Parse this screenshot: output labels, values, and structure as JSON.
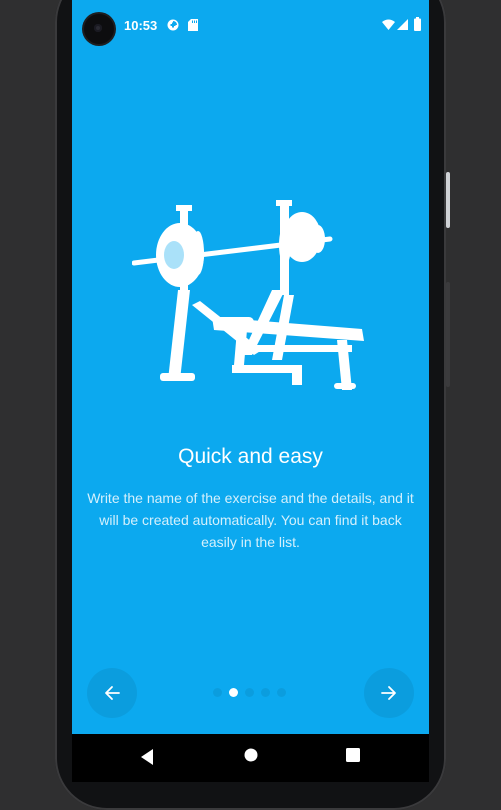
{
  "status_bar": {
    "time": "10:53",
    "icons": [
      "data-saver-icon",
      "sd-card-icon",
      "wifi-icon",
      "signal-icon",
      "battery-icon"
    ]
  },
  "onboarding": {
    "illustration": "bench-press-icon",
    "title": "Quick and easy",
    "description": "Write the name of the exercise and the details, and it will be created automatically. You can find it back easily in the list.",
    "page_indicator": {
      "total": 5,
      "active_index": 1
    },
    "prev_icon": "arrow-left-icon",
    "next_icon": "arrow-right-icon"
  },
  "system_nav": [
    "back-icon",
    "home-icon",
    "recents-icon"
  ],
  "colors": {
    "background": "#0ca9ef",
    "text": "#ffffff",
    "nav_bar": "#000000",
    "device_frame": "#111214"
  }
}
